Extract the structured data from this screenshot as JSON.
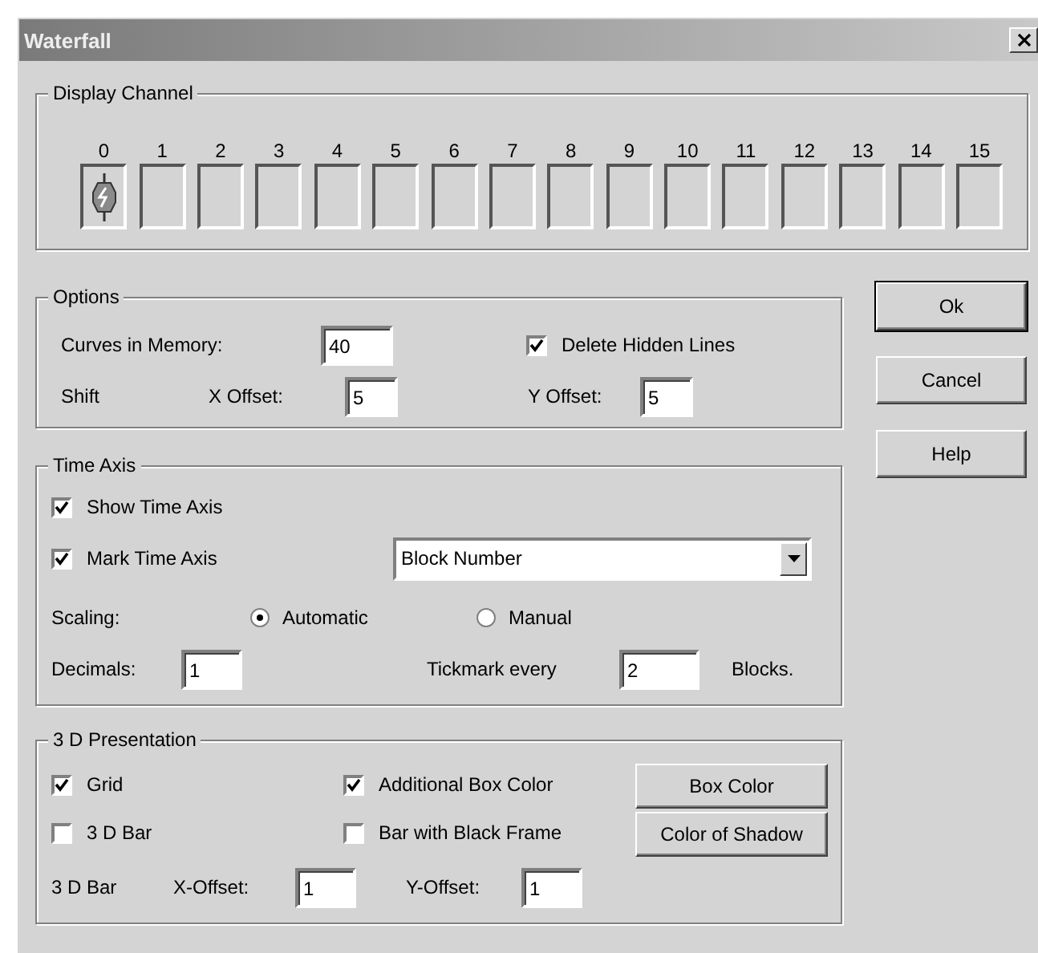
{
  "window": {
    "title": "Waterfall"
  },
  "display_channel": {
    "title": "Display Channel",
    "channels": [
      {
        "label": "0",
        "selected": true
      },
      {
        "label": "1",
        "selected": false
      },
      {
        "label": "2",
        "selected": false
      },
      {
        "label": "3",
        "selected": false
      },
      {
        "label": "4",
        "selected": false
      },
      {
        "label": "5",
        "selected": false
      },
      {
        "label": "6",
        "selected": false
      },
      {
        "label": "7",
        "selected": false
      },
      {
        "label": "8",
        "selected": false
      },
      {
        "label": "9",
        "selected": false
      },
      {
        "label": "10",
        "selected": false
      },
      {
        "label": "11",
        "selected": false
      },
      {
        "label": "12",
        "selected": false
      },
      {
        "label": "13",
        "selected": false
      },
      {
        "label": "14",
        "selected": false
      },
      {
        "label": "15",
        "selected": false
      }
    ]
  },
  "options": {
    "title": "Options",
    "curves_label": "Curves in Memory:",
    "curves_value": "40",
    "delete_hidden": {
      "label": "Delete Hidden Lines",
      "checked": true
    },
    "shift_label": "Shift",
    "x_offset_label": "X Offset:",
    "x_offset_value": "5",
    "y_offset_label": "Y Offset:",
    "y_offset_value": "5"
  },
  "time_axis": {
    "title": "Time Axis",
    "show": {
      "label": "Show Time Axis",
      "checked": true
    },
    "mark": {
      "label": "Mark Time Axis",
      "checked": true
    },
    "mark_select": "Block Number",
    "scaling_label": "Scaling:",
    "scaling": [
      {
        "label": "Automatic",
        "selected": true
      },
      {
        "label": "Manual",
        "selected": false
      }
    ],
    "decimals_label": "Decimals:",
    "decimals_value": "1",
    "tickmark_label": "Tickmark every",
    "tickmark_value": "2",
    "blocks_label": "Blocks."
  },
  "presentation": {
    "title": "3 D Presentation",
    "checks": [
      {
        "label": "Grid",
        "checked": true
      },
      {
        "label": "Additional Box Color",
        "checked": true
      },
      {
        "label": "3 D Bar",
        "checked": false
      },
      {
        "label": "Bar with Black Frame",
        "checked": false
      }
    ],
    "buttons": [
      "Box Color",
      "Color of Shadow"
    ],
    "bar_label": "3 D Bar",
    "x_label": "X-Offset:",
    "x_value": "1",
    "y_label": "Y-Offset:",
    "y_value": "1"
  },
  "buttons": [
    {
      "label": "Ok",
      "default": true
    },
    {
      "label": "Cancel",
      "default": false
    },
    {
      "label": "Help",
      "default": false
    }
  ]
}
